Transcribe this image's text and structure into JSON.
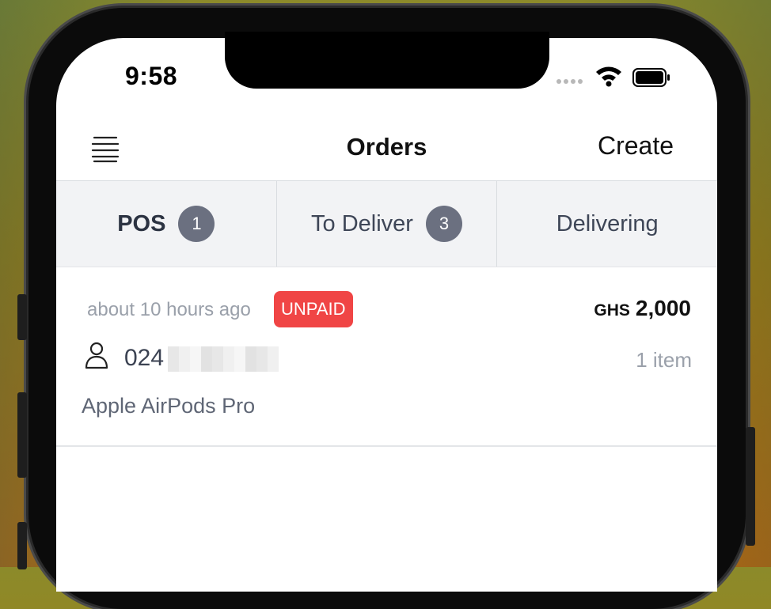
{
  "status_bar": {
    "time": "9:58"
  },
  "header": {
    "title": "Orders",
    "create_label": "Create"
  },
  "tabs": [
    {
      "label": "POS",
      "badge": "1",
      "active": true
    },
    {
      "label": "To Deliver",
      "badge": "3",
      "active": false
    },
    {
      "label": "Delivering",
      "badge": null,
      "active": false
    }
  ],
  "orders": [
    {
      "time_ago": "about 10 hours ago",
      "status": "UNPAID",
      "currency": "GHS",
      "total": "2,000",
      "phone_visible": "024",
      "item_count": "1 item",
      "product": "Apple AirPods Pro"
    }
  ],
  "colors": {
    "unpaid": "#f04545",
    "badge": "#6b7080",
    "tab_bg": "#f2f3f5"
  },
  "icons": {
    "menu": "stack-menu-icon",
    "user": "user-icon",
    "wifi": "wifi-icon",
    "battery": "battery-icon"
  }
}
